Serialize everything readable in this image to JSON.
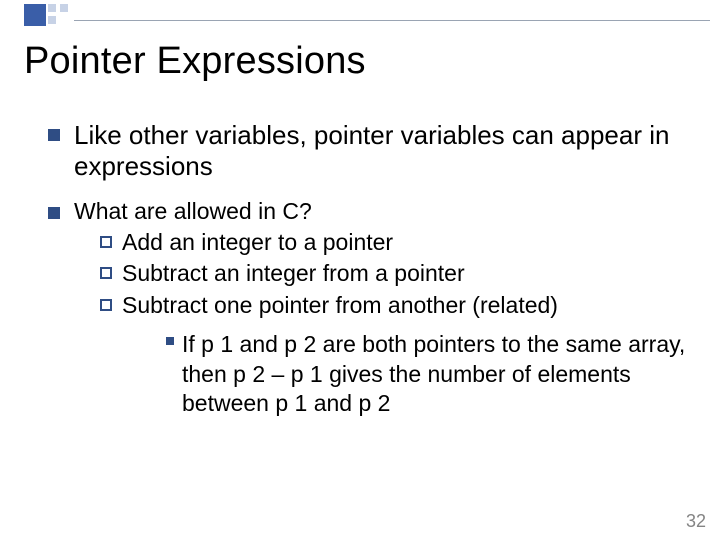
{
  "title": "Pointer Expressions",
  "bullets": {
    "b1": "Like other variables, pointer variables can appear in expressions",
    "b2": "What are allowed in C?",
    "sub1": "Add an integer to a pointer",
    "sub2": "Subtract an integer from a pointer",
    "sub3": "Subtract one pointer from another (related)",
    "note": "If p 1 and p 2 are both pointers to the same array, then  p 2 – p 1 gives the number of elements between p 1 and p 2"
  },
  "page_number": "32"
}
